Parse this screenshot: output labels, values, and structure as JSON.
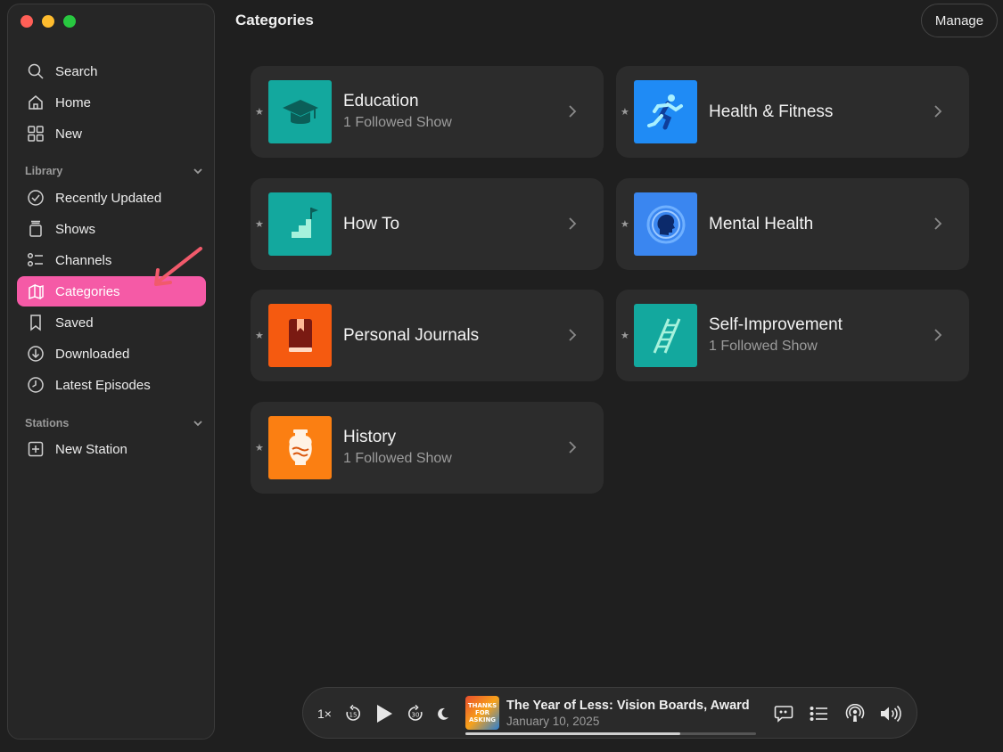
{
  "header": {
    "title": "Categories",
    "manage_label": "Manage"
  },
  "sidebar": {
    "top_items": [
      {
        "label": "Search",
        "icon": "search-icon"
      },
      {
        "label": "Home",
        "icon": "home-icon"
      },
      {
        "label": "New",
        "icon": "grid-icon"
      }
    ],
    "library_label": "Library",
    "library_items": [
      {
        "label": "Recently Updated",
        "icon": "checkmark-circle-icon"
      },
      {
        "label": "Shows",
        "icon": "stack-icon"
      },
      {
        "label": "Channels",
        "icon": "list-icon"
      },
      {
        "label": "Categories",
        "icon": "categories-icon",
        "active": true
      },
      {
        "label": "Saved",
        "icon": "bookmark-icon"
      },
      {
        "label": "Downloaded",
        "icon": "download-icon"
      },
      {
        "label": "Latest Episodes",
        "icon": "clock-icon"
      }
    ],
    "stations_label": "Stations",
    "stations_items": [
      {
        "label": "New Station",
        "icon": "plus-square-icon"
      }
    ],
    "accent_color": "#f55aa6"
  },
  "categories": [
    {
      "name": "Education",
      "subtitle": "1 Followed Show",
      "color": "#13a89e",
      "icon": "graduation-cap-icon"
    },
    {
      "name": "Health & Fitness",
      "subtitle": "",
      "color": "#1f8bf5",
      "icon": "runner-icon"
    },
    {
      "name": "How To",
      "subtitle": "",
      "color": "#13a89e",
      "icon": "stairs-flag-icon"
    },
    {
      "name": "Mental Health",
      "subtitle": "",
      "color": "#3a86f0",
      "icon": "head-icon"
    },
    {
      "name": "Personal Journals",
      "subtitle": "",
      "color": "#f55a10",
      "icon": "journal-icon"
    },
    {
      "name": "Self-Improvement",
      "subtitle": "1 Followed Show",
      "color": "#13a89e",
      "icon": "ladder-icon"
    },
    {
      "name": "History",
      "subtitle": "1 Followed Show",
      "color": "#fb7f12",
      "icon": "vase-icon"
    }
  ],
  "player": {
    "speed": "1×",
    "skip_back": "15",
    "skip_forward": "30",
    "episode_title": "The Year of Less: Vision Boards, Award",
    "episode_date": "January 10, 2025",
    "artwork_text": "THANKS FOR ASKING",
    "progress": 0.74
  }
}
